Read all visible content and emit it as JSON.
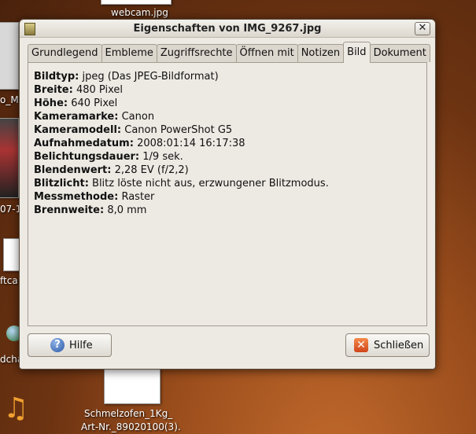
{
  "desktop": {
    "labels": [
      "webcam.jpg",
      "o_Ma",
      "07-1",
      "ftca",
      "dcha",
      "Schmelzofen_1Kg_",
      "Art-Nr._89020100(3)."
    ]
  },
  "window": {
    "title": "Eigenschaften von IMG_9267.jpg",
    "close_glyph": "✕",
    "tabs": [
      "Grundlegend",
      "Embleme",
      "Zugriffsrechte",
      "Öffnen mit",
      "Notizen",
      "Bild",
      "Dokument"
    ],
    "active_tab": "Bild",
    "properties": [
      {
        "label": "Bildtyp:",
        "value": "jpeg (Das JPEG-Bildformat)"
      },
      {
        "label": "Breite:",
        "value": "480 Pixel"
      },
      {
        "label": "Höhe:",
        "value": "640 Pixel"
      },
      {
        "label": "Kameramarke:",
        "value": "Canon"
      },
      {
        "label": "Kameramodell:",
        "value": "Canon PowerShot G5"
      },
      {
        "label": "Aufnahmedatum:",
        "value": "2008:01:14 16:17:38"
      },
      {
        "label": "Belichtungsdauer:",
        "value": "1/9 sek."
      },
      {
        "label": "Blendenwert:",
        "value": "2,28 EV (f/2,2)"
      },
      {
        "label": "Blitzlicht:",
        "value": "Blitz löste nicht aus, erzwungener Blitzmodus."
      },
      {
        "label": "Messmethode:",
        "value": "Raster"
      },
      {
        "label": "Brennweite:",
        "value": "8,0 mm"
      }
    ],
    "help_button": "Hilfe",
    "close_button": "Schließen"
  },
  "icons": {
    "help": "help-icon",
    "close": "close-icon",
    "music": "music-note-icon"
  }
}
